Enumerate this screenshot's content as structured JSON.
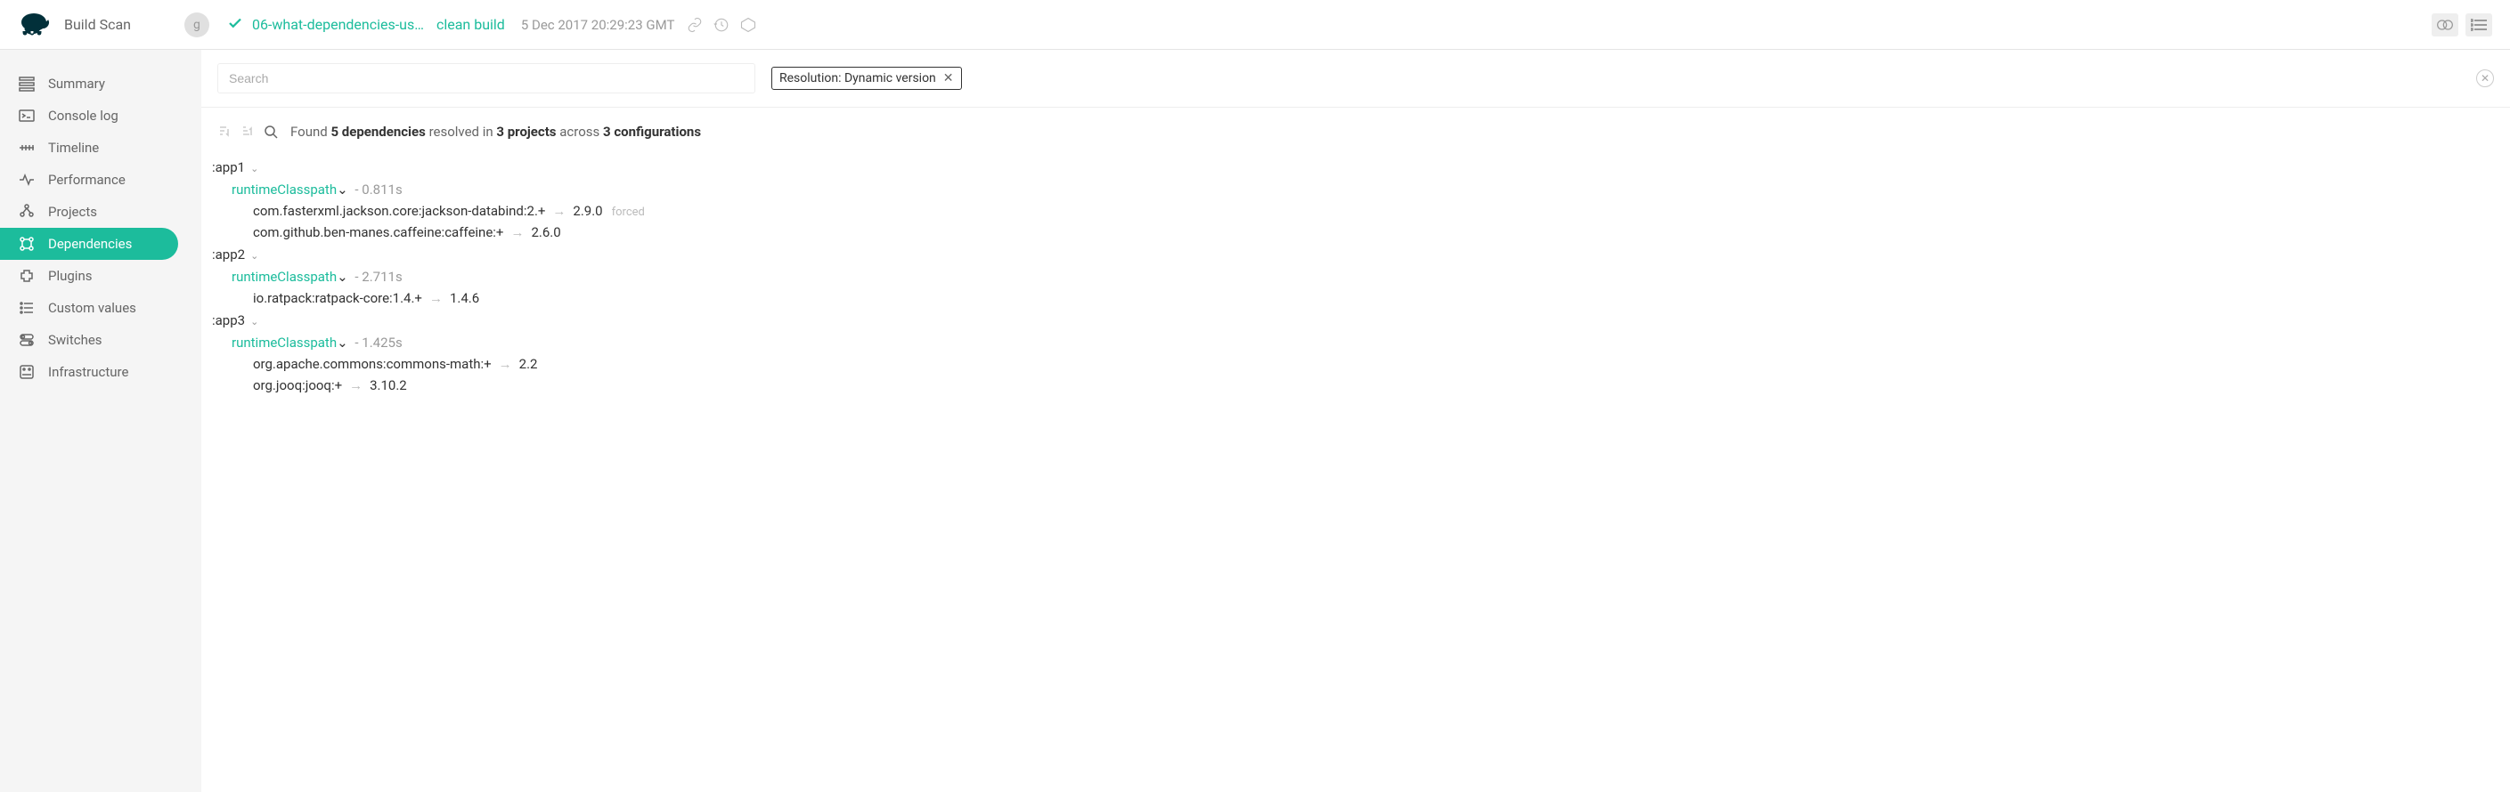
{
  "header": {
    "brand": "Build Scan",
    "avatar": "g",
    "project": "06-what-dependencies-us…",
    "tasks": "clean build",
    "timestamp": "5 Dec 2017 20:29:23 GMT"
  },
  "sidebar": {
    "items": [
      {
        "label": "Summary",
        "icon": "summary"
      },
      {
        "label": "Console log",
        "icon": "console"
      },
      {
        "label": "Timeline",
        "icon": "timeline"
      },
      {
        "label": "Performance",
        "icon": "performance"
      },
      {
        "label": "Projects",
        "icon": "projects"
      },
      {
        "label": "Dependencies",
        "icon": "dependencies"
      },
      {
        "label": "Plugins",
        "icon": "plugins"
      },
      {
        "label": "Custom values",
        "icon": "custom"
      },
      {
        "label": "Switches",
        "icon": "switches"
      },
      {
        "label": "Infrastructure",
        "icon": "infra"
      }
    ]
  },
  "search": {
    "placeholder": "Search",
    "filter_label": "Resolution: Dynamic version"
  },
  "summary": {
    "prefix": "Found",
    "depCount": "5",
    "depWord": "dependencies",
    "mid1": "resolved in",
    "projCount": "3",
    "projWord": "projects",
    "mid2": "across",
    "cfgCount": "3",
    "cfgWord": "configurations"
  },
  "tree": [
    {
      "project": ":app1",
      "configs": [
        {
          "name": "runtimeClasspath",
          "time": "- 0.811s",
          "deps": [
            {
              "requested": "com.fasterxml.jackson.core:jackson-databind:2.+",
              "resolved": "2.9.0",
              "badge": "forced"
            },
            {
              "requested": "com.github.ben-manes.caffeine:caffeine:+",
              "resolved": "2.6.0",
              "badge": ""
            }
          ]
        }
      ]
    },
    {
      "project": ":app2",
      "configs": [
        {
          "name": "runtimeClasspath",
          "time": "- 2.711s",
          "deps": [
            {
              "requested": "io.ratpack:ratpack-core:1.4.+",
              "resolved": "1.4.6",
              "badge": ""
            }
          ]
        }
      ]
    },
    {
      "project": ":app3",
      "configs": [
        {
          "name": "runtimeClasspath",
          "time": "- 1.425s",
          "deps": [
            {
              "requested": "org.apache.commons:commons-math:+",
              "resolved": "2.2",
              "badge": ""
            },
            {
              "requested": "org.jooq:jooq:+",
              "resolved": "3.10.2",
              "badge": ""
            }
          ]
        }
      ]
    }
  ]
}
